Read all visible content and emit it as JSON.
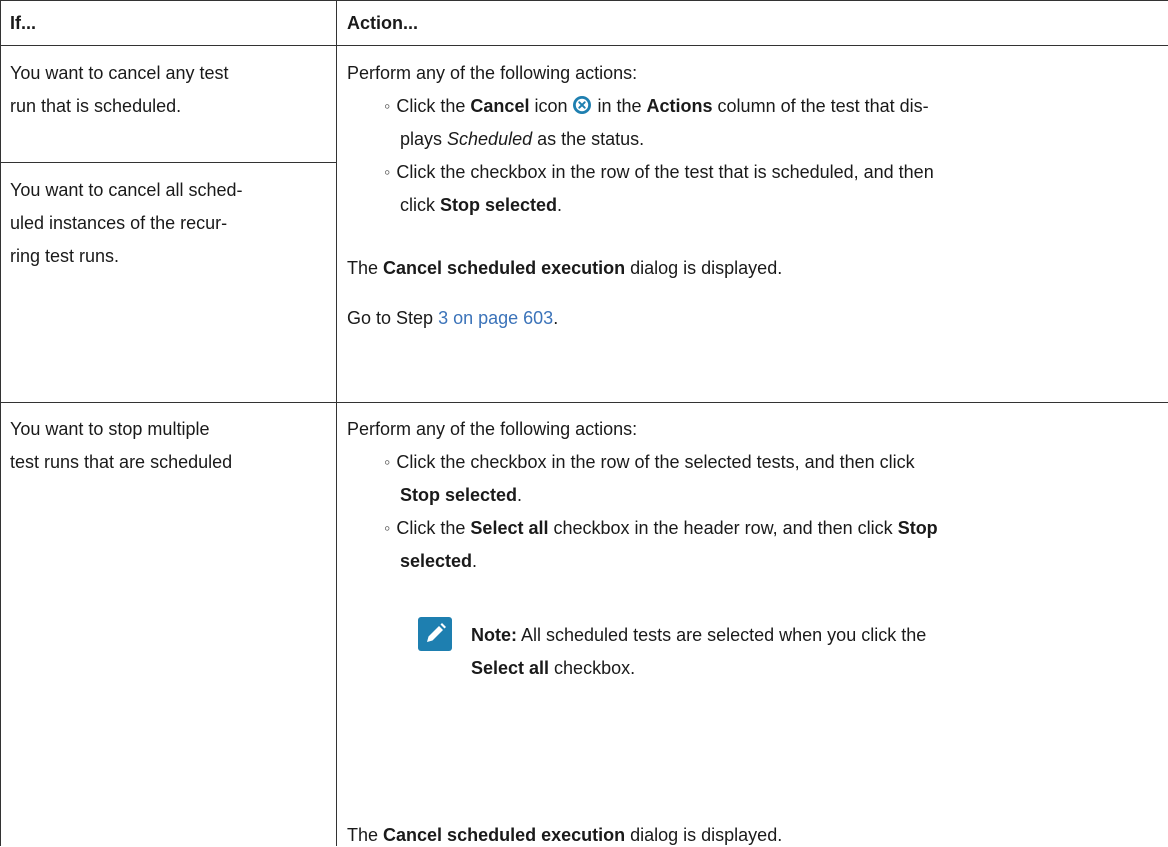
{
  "header": {
    "if_label": "If...",
    "action_label": "Action..."
  },
  "rows": [
    {
      "conditions": [
        [
          "You want to cancel any test",
          "run that is scheduled."
        ],
        [
          "You want to cancel all sched-",
          "uled instances of the recur-",
          "ring test runs."
        ]
      ],
      "intro": "Perform any of the following actions:",
      "b1": {
        "p1": "Click the ",
        "cancel": "Cancel",
        "p2": " icon ",
        "p3": " in the ",
        "actions": "Actions",
        "p4": " column of the test that dis-",
        "p5": "plays ",
        "scheduled": "Scheduled",
        "p6": " as the status."
      },
      "b2": {
        "p1": "Click the checkbox in the row of the test that is scheduled, and then",
        "p2": "click ",
        "stop": "Stop selected",
        "p3": "."
      },
      "dialog": {
        "p1": "The ",
        "name": "Cancel scheduled execution",
        "p2": " dialog is displayed."
      },
      "goto": {
        "p1": "Go to Step ",
        "link": "3 on page 603",
        "p2": "."
      }
    },
    {
      "conditions": [
        [
          "You want to stop multiple",
          "test runs that are scheduled"
        ]
      ],
      "intro": "Perform any of the following actions:",
      "b1": {
        "p1": "Click the checkbox in the row of the selected tests, and then click",
        "stop": "Stop selected",
        "p2": "."
      },
      "b2": {
        "p1": "Click the ",
        "select_all": "Select all",
        "p2": " checkbox in the header row, and then click ",
        "stop1": "Stop",
        "stop2": "selected",
        "p3": "."
      },
      "note": {
        "label": "Note:",
        "p1": " All scheduled tests are selected when you click the",
        "select_all": "Select all",
        "p2": " checkbox."
      },
      "dialog": {
        "p1": "The ",
        "name": "Cancel scheduled execution",
        "p2": " dialog is displayed."
      }
    }
  ],
  "icons": {
    "cancel_icon_color": "#1e7fb0",
    "note_icon_color": "#1e7fb0",
    "link_color": "#3b73b9"
  }
}
